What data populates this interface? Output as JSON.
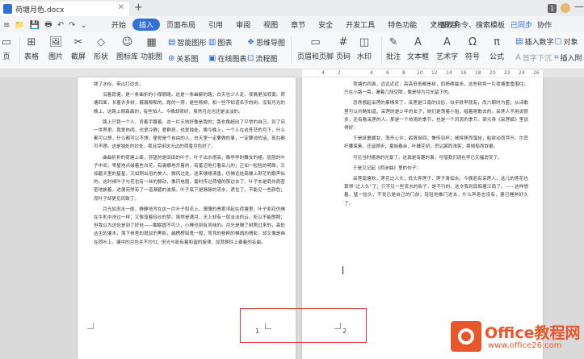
{
  "titlebar": {
    "doc_tab": "荷塘月色.docx",
    "close": "✕",
    "new_tab": "+",
    "window_number": "1",
    "minimize": "—"
  },
  "menu": {
    "file_menu": "≡",
    "tabs": [
      "开始",
      "插入",
      "页面布局",
      "引用",
      "审阅",
      "视图",
      "章节",
      "安全",
      "开发工具",
      "特色功能",
      "文档助手"
    ],
    "active_tab": "插入",
    "search_placeholder": "查找命令、搜索模板",
    "cloud": "已同步",
    "collab": "协作"
  },
  "ribbon": {
    "page": "页",
    "table": "表格",
    "picture": "图片",
    "screenshot": "截屏",
    "shapes": "形状",
    "icon_lib": "图标库",
    "function_chart": "功能图",
    "smart_graphic": "智能图形",
    "chart": "图表",
    "mind_map": "思维导图",
    "relation": "关系图",
    "online_chart": "在线图表",
    "flow_chart": "流程图",
    "header_footer": "页眉和页脚",
    "page_number": "页码",
    "watermark": "水印",
    "comment": "批注",
    "textbox": "文本框",
    "wordart": "艺术字",
    "symbol": "符号",
    "formula": "公式",
    "insert_number": "插入数字",
    "object": "对象",
    "first_drop": "首字下沉",
    "insert_attachment": "插入附"
  },
  "ruler": {
    "ticks": [
      "4",
      "2",
      "4",
      "6",
      "8",
      "10",
      "12",
      "14",
      "16",
      "18",
      "20",
      "22",
      "24",
      "26"
    ]
  },
  "pages": {
    "left_paragraphs": [
      "拨了水似，带山打边去。",
      "沿着荷塘，是一条曲折的小煤屑路。这是一条幽僻的路；白天也少人走，夜晚更加寂寞。荷塘四面，长着许多树，蓊蓊郁郁的。路的一旁，是些杨柳，和一些不知道名字的树。没有月光的晚上，这路上阴森森的，有些怕人。今晚却很好，虽然月光也还是淡淡的。",
      "路上只我一个人，背着手踱着。这一片天地好像是我的；我也像超出了平常的自己，到了另一世界里。我爱热闹，也爱冷静；爱群居，也爱独处。像今晚上，一个人在这苍茫的月下，什么都可以想，什么都可以不想，便觉是个自由的人。白天里一定要做的事，一定要说的话，现在都可不理。这是独处的妙处，我且受用这无边的荷香月色好了。",
      "曲曲折折的荷塘上面，弥望的是田田的叶子。叶子出水很高，像亭亭的舞女的裙。层层的叶子中间，零星地点缀着些白花，有袅娜地开着的，有羞涩地打着朵儿的；正如一粒粒的明珠，又如碧天里的星星，又如刚出浴的美人。微风过处，送来缕缕清香，仿佛远处高楼上渺茫的歌声似的。这时候叶子与花也有一丝的颤动，像闪电般，霎时传过荷塘的那边去了。叶子本是肩并肩密密地挨着，这便宛然有了一道凝碧的波痕。叶子底下是脉脉的流水，遮住了，不能见一些颜色；而叶子却更见风致了。",
      "月光如流水一般，静静地泻在这一片叶子和花上。薄薄的青雾浮起在荷塘里。叶子和花仿佛在牛乳中洗过一样；又像笼着轻纱的梦。虽然是满月，天上却有一层淡淡的云，所以不能朗照；但我以为这恰是到了好处——酣眠固不可少，小睡也别有风味的。月光是隔了树照过来的，高处丛生的灌木，落下参差的斑驳的黑影，峭楞楞如鬼一般；弯弯的杨柳的稀疏的倩影，却又像是画在荷叶上。塘中的月色并不均匀；但光与影有着和谐的旋律，如梵婀玲上奏着的名曲。"
    ],
    "right_paragraphs": [
      "荷塘的四面，远远近近，高高低低都是树，而杨柳最多。这些树将一片荷塘重重围住；只在小路一旁，漏着几段空隙，像是特为月光留下的。",
      "忽然想起采莲的事情来了。采莲是江南的旧俗，似乎很早就有，而六朝时为盛；从诗歌里可以约略知道。采莲的是少年的女子，她们是荡着小船，唱着艳歌去的。采莲人不用说很多，还有看采莲的人。那是一个热闹的季节，也是一个风流的季节。梁元帝《采莲赋》里说得好：",
      "于是妖童媛女，荡舟心许；鹢首徐回，兼传羽杯；棹将移而藻挂，船欲动而萍开。尔其纤腰束素，迁延顾步；夏始春余，叶嫩花初，恐沾裳而浅笑，畏倾船而敛裾。",
      "可见当时嬉游的光景了。这真是有趣的事，可惜我们现在早已无福消受了。",
      "于是又记起《西洲曲》里的句子：",
      "采莲南塘秋，莲花过人头；低头弄莲子，莲子清如水。今晚若有采莲人，这儿的莲花也算得“过人头”了；只不见一些流水的影子，是不行的。这令我到底惦着江南了。——这样想着，猛一抬头，不觉已是自己的门前；轻轻地推门进去，什么声息也没有，妻已睡熟好久了。"
    ],
    "left_page_number": "1",
    "right_page_number": "2"
  },
  "watermark": {
    "name": "Office教程网",
    "url": "www.office26.com"
  }
}
